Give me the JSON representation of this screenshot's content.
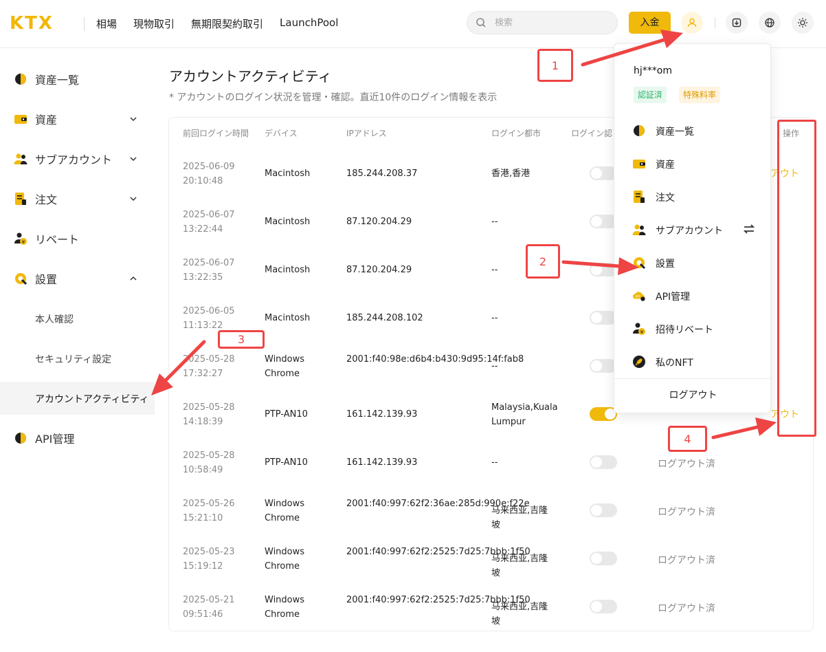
{
  "header": {
    "logo": "KTX",
    "nav": [
      "相場",
      "現物取引",
      "無期限契約取引",
      "LaunchPool"
    ],
    "search_placeholder": "検索",
    "deposit_label": "入金"
  },
  "sidebar": {
    "items": [
      {
        "label": "資産一覧"
      },
      {
        "label": "資産"
      },
      {
        "label": "サブアカウント"
      },
      {
        "label": "注文"
      },
      {
        "label": "リベート"
      },
      {
        "label": "設置"
      },
      {
        "label": "API管理"
      }
    ],
    "sub_items": [
      {
        "label": "本人確認"
      },
      {
        "label": "セキュリティ設定"
      },
      {
        "label": "アカウントアクティビティ"
      }
    ]
  },
  "main": {
    "title": "アカウントアクティビティ",
    "subtitle": "* アカウントのログイン状況を管理・確認。直近10件のログイン情報を表示",
    "columns": [
      "前回ログイン時間",
      "デバイス",
      "IPアドレス",
      "ログイン都市",
      "ログイン認",
      "操作"
    ],
    "rows": [
      {
        "date": "2025-06-09",
        "time": "20:10:48",
        "device": "Macintosh",
        "ip": "185.244.208.37",
        "city": "香港,香港",
        "toggle_on": false,
        "status": "",
        "action": "アウト"
      },
      {
        "date": "2025-06-07",
        "time": "13:22:44",
        "device": "Macintosh",
        "ip": "87.120.204.29",
        "city": "--",
        "toggle_on": false,
        "status": "",
        "action": ""
      },
      {
        "date": "2025-06-07",
        "time": "13:22:35",
        "device": "Macintosh",
        "ip": "87.120.204.29",
        "city": "--",
        "toggle_on": false,
        "status": "",
        "action": ""
      },
      {
        "date": "2025-06-05",
        "time": "11:13:22",
        "device": "Macintosh",
        "ip": "185.244.208.102",
        "city": "--",
        "toggle_on": false,
        "status": "",
        "action": ""
      },
      {
        "date": "2025-05-28",
        "time": "17:32:27",
        "device": "Windows Chrome",
        "ip": "2001:f40:98e:d6b4:b430:9d95:14f:fab8",
        "city": "--",
        "toggle_on": false,
        "status": "",
        "action": ""
      },
      {
        "date": "2025-05-28",
        "time": "14:18:39",
        "device": "PTP-AN10",
        "ip": "161.142.139.93",
        "city": "Malaysia,Kuala Lumpur",
        "toggle_on": true,
        "status": "",
        "action": "アウト"
      },
      {
        "date": "2025-05-28",
        "time": "10:58:49",
        "device": "PTP-AN10",
        "ip": "161.142.139.93",
        "city": "--",
        "toggle_on": false,
        "status": "ログアウト済",
        "action": ""
      },
      {
        "date": "2025-05-26",
        "time": "15:21:10",
        "device": "Windows Chrome",
        "ip": "2001:f40:997:62f2:36ae:285d:990e:f22e",
        "city": "马来西亚,吉隆坡",
        "toggle_on": false,
        "status": "ログアウト済",
        "action": ""
      },
      {
        "date": "2025-05-23",
        "time": "15:19:12",
        "device": "Windows Chrome",
        "ip": "2001:f40:997:62f2:2525:7d25:7bbb:1f50",
        "city": "马来西亚,吉隆坡",
        "toggle_on": false,
        "status": "ログアウト済",
        "action": ""
      },
      {
        "date": "2025-05-21",
        "time": "09:51:46",
        "device": "Windows Chrome",
        "ip": "2001:f40:997:62f2:2525:7d25:7bbb:1f50",
        "city": "马来西亚,吉隆坡",
        "toggle_on": false,
        "status": "ログアウト済",
        "action": ""
      }
    ]
  },
  "dropdown": {
    "username": "hj***om",
    "badges": [
      "認証済",
      "特殊料率"
    ],
    "items": [
      {
        "label": "資産一覧",
        "icon": "pie-chart-icon"
      },
      {
        "label": "資産",
        "icon": "wallet-icon"
      },
      {
        "label": "注文",
        "icon": "order-icon"
      },
      {
        "label": "サブアカウント",
        "icon": "users-icon"
      },
      {
        "label": "設置",
        "icon": "settings-icon"
      },
      {
        "label": "API管理",
        "icon": "api-cloud-icon"
      },
      {
        "label": "招待リベート",
        "icon": "rebate-icon"
      },
      {
        "label": "私のNFT",
        "icon": "rocket-icon"
      }
    ],
    "logout": "ログアウト"
  },
  "annotations": [
    "1",
    "2",
    "3",
    "4"
  ],
  "colors": {
    "accent": "#f0b90b",
    "annotation": "#ee4444"
  }
}
